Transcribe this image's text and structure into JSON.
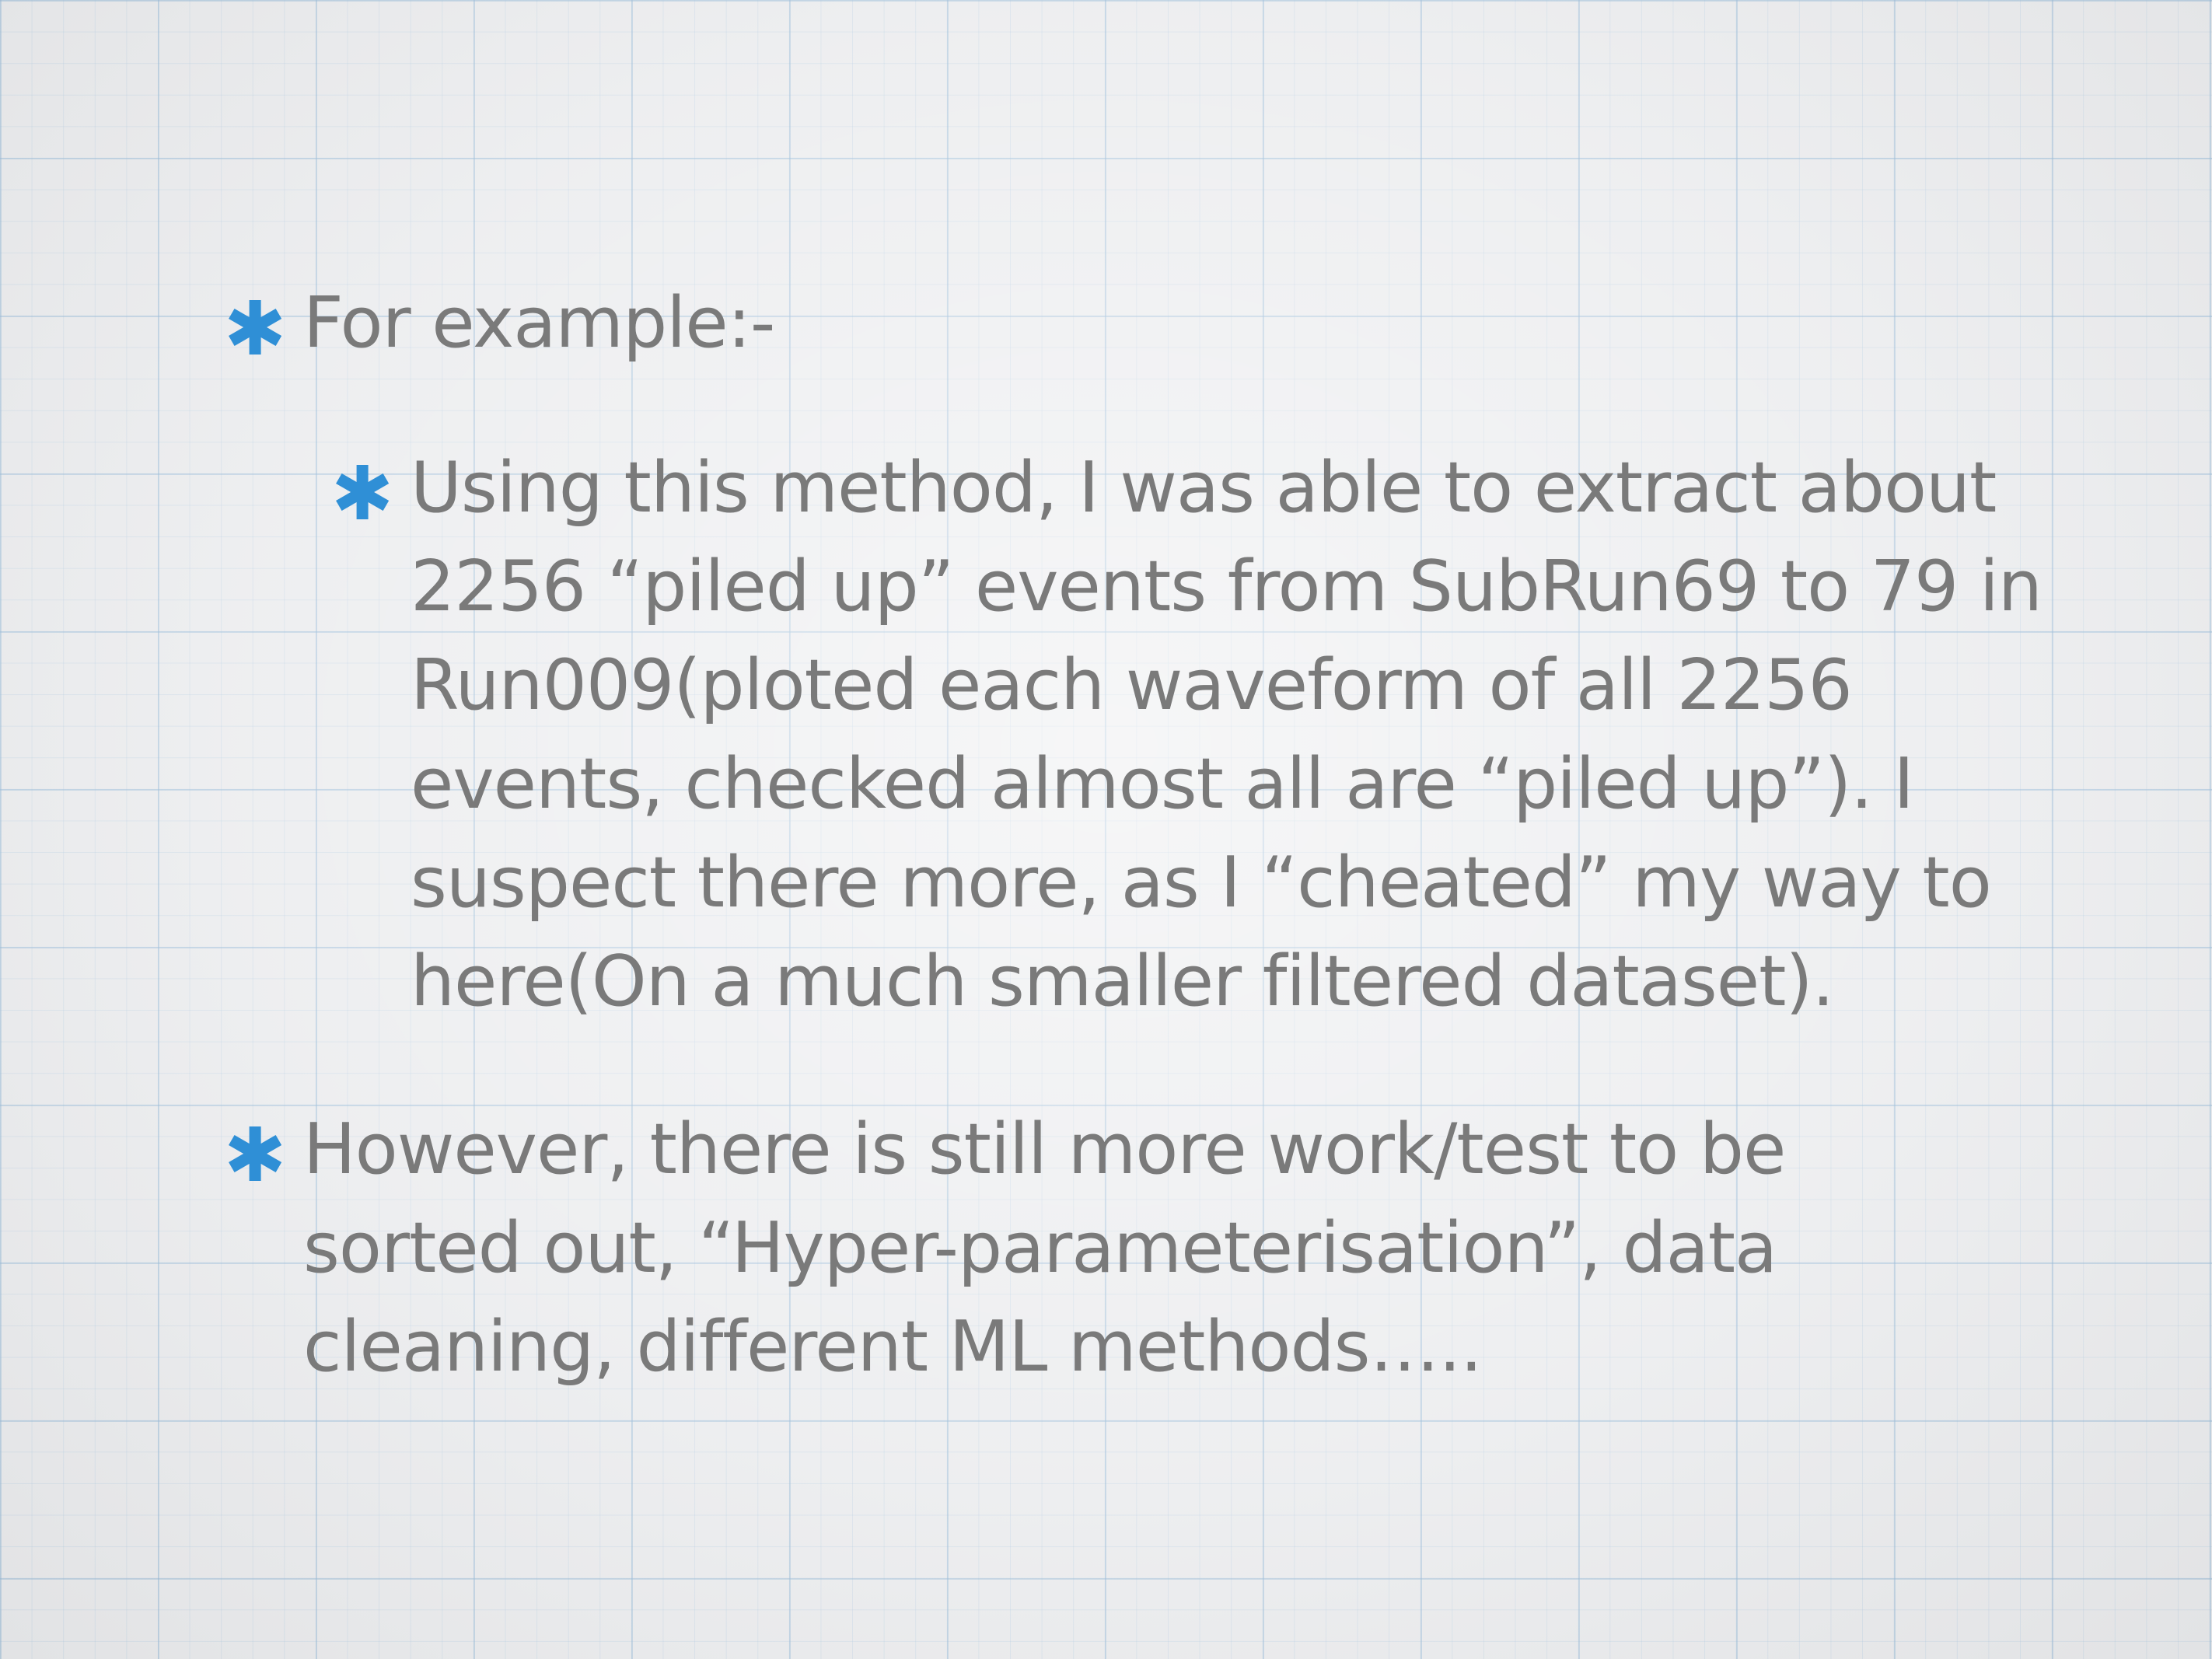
{
  "slide": {
    "bullets": [
      {
        "level": 1,
        "marker": "asterisk-icon",
        "text": "For example:-"
      },
      {
        "level": 2,
        "marker": "asterisk-icon",
        "text": "Using this method, I was able to extract about\n2256 “piled up” events from SubRun69 to 79 in\nRun009(ploted each waveform of all 2256\nevents, checked almost all are “piled up”). I\nsuspect there more, as I “cheated” my way to\nhere(On a much smaller filtered dataset)."
      },
      {
        "level": 1,
        "marker": "asterisk-icon",
        "text": "However, there is still more work/test to be\nsorted out, “Hyper-parameterisation”, data\ncleaning, different ML methods….."
      }
    ],
    "colors": {
      "text": "#7a7a7a",
      "bullet_marker": "#2f8fd6",
      "background": "#ebecee",
      "grid": "#96b9d7"
    }
  }
}
